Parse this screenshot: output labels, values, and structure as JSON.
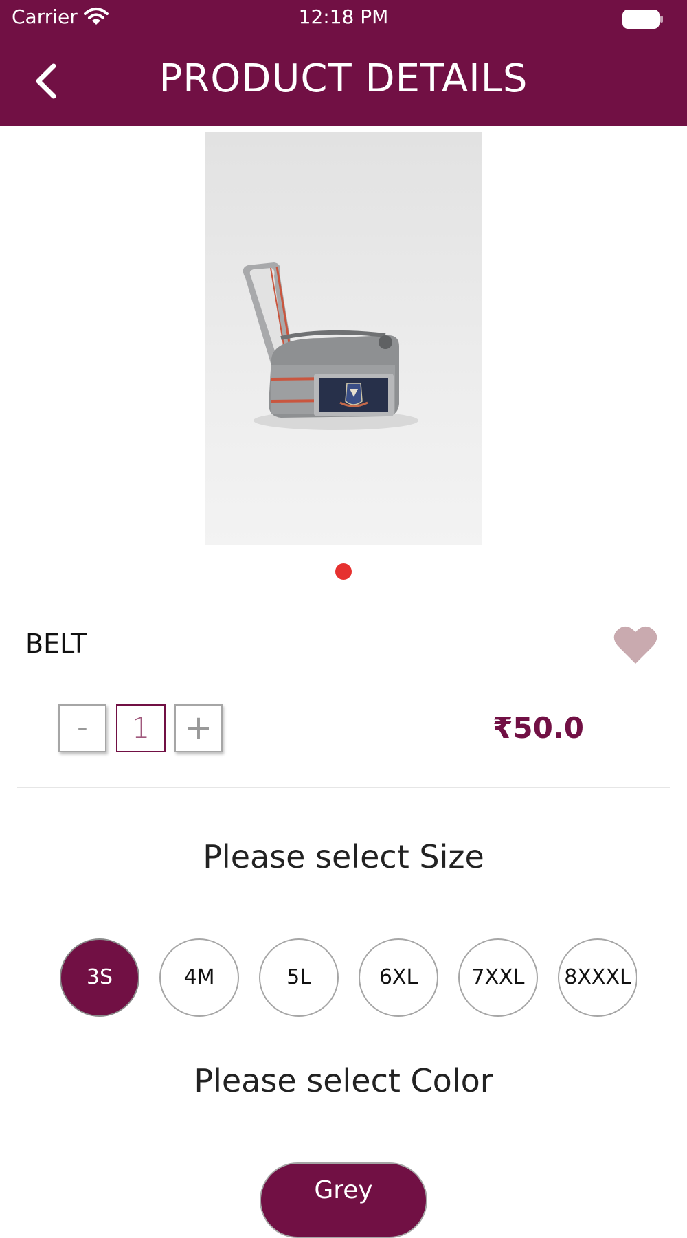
{
  "status_bar": {
    "carrier": "Carrier",
    "time": "12:18 PM",
    "wifi_icon": "wifi-icon",
    "battery_icon": "battery-icon"
  },
  "header": {
    "back_icon": "chevron-left-icon",
    "title": "PRODUCT DETAILS",
    "background": "#711044"
  },
  "product": {
    "image_description_icon": "product-photo",
    "carousel_page": 1,
    "carousel_pages": 1,
    "name": "BELT",
    "favorite_icon": "heart-icon",
    "price": "₹50.0"
  },
  "quantity": {
    "minus_label": "-",
    "value": "1",
    "plus_label": "+"
  },
  "size": {
    "heading": "Please select Size",
    "options": [
      "3S",
      "4M",
      "5L",
      "6XL",
      "7XXL",
      "8XXXL"
    ],
    "selected": "3S"
  },
  "color": {
    "heading": "Please select Color",
    "options": [
      "Grey"
    ],
    "selected": "Grey"
  },
  "colors": {
    "brand": "#711044",
    "dot_active": "#e6312f",
    "heart": "#c9aaaf"
  }
}
